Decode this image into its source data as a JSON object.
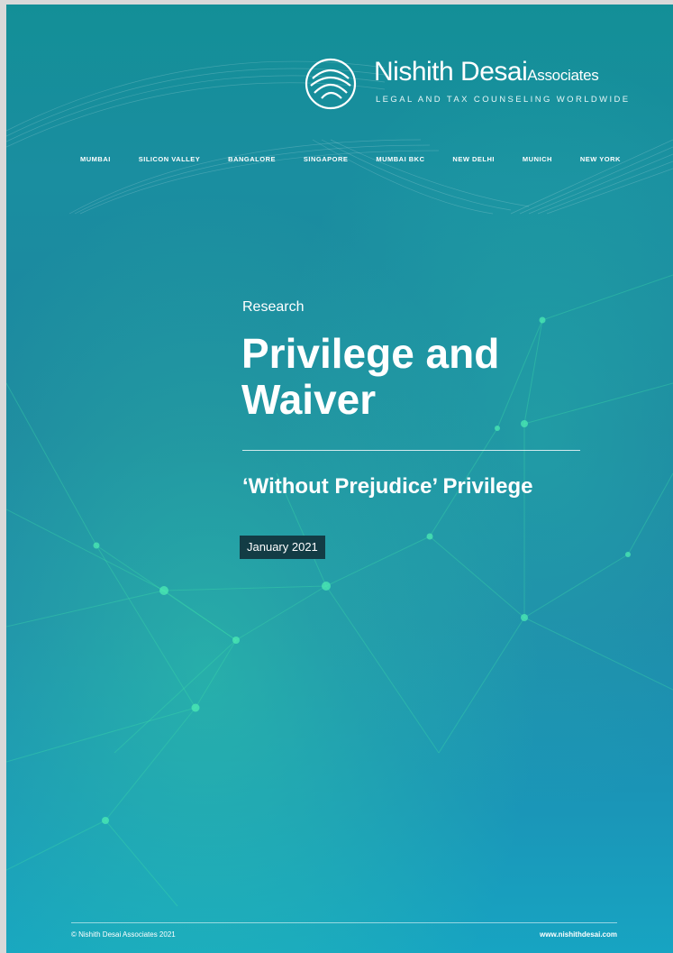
{
  "header": {
    "brand_main": "Nishith Desai",
    "brand_suffix": "Associates",
    "tagline": "LEGAL AND TAX COUNSELING WORLDWIDE",
    "offices": [
      "MUMBAI",
      "SILICON VALLEY",
      "BANGALORE",
      "SINGAPORE",
      "MUMBAI BKC",
      "NEW DELHI",
      "MUNICH",
      "NEW YORK"
    ]
  },
  "cover": {
    "label": "Research",
    "title": "Privilege and Waiver",
    "subtitle": "‘Without Prejudice’ Privilege",
    "date": "January 2021"
  },
  "footer": {
    "copyright": "© Nishith Desai Associates 2021",
    "website": "www.nishithdesai.com"
  },
  "colors": {
    "background_top": "#138f97",
    "background_bottom": "#17a4c2",
    "network_lines": "#3fe0a8",
    "date_badge": "#133c45"
  }
}
